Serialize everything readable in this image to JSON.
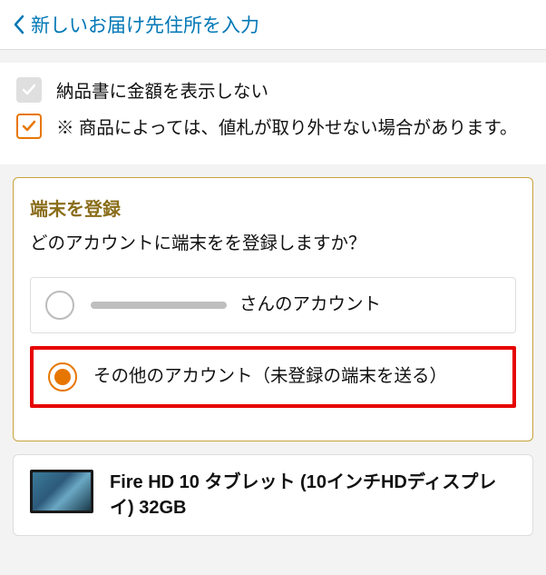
{
  "header": {
    "title": "新しいお届け先住所を入力"
  },
  "checkboxes": {
    "hide_amount_label": "納品書に金額を表示しない",
    "note_label": "※ 商品によっては、値札が取り外せない場合があります。"
  },
  "register": {
    "title": "端末を登録",
    "subtitle": "どのアカウントに端末をを登録しますか？",
    "options": {
      "user_account_suffix": "さんのアカウント",
      "other_account": "その他のアカウント（未登録の端末を送る）"
    }
  },
  "product": {
    "title": "Fire HD 10 タブレット (10インチHDディスプレイ) 32GB"
  }
}
